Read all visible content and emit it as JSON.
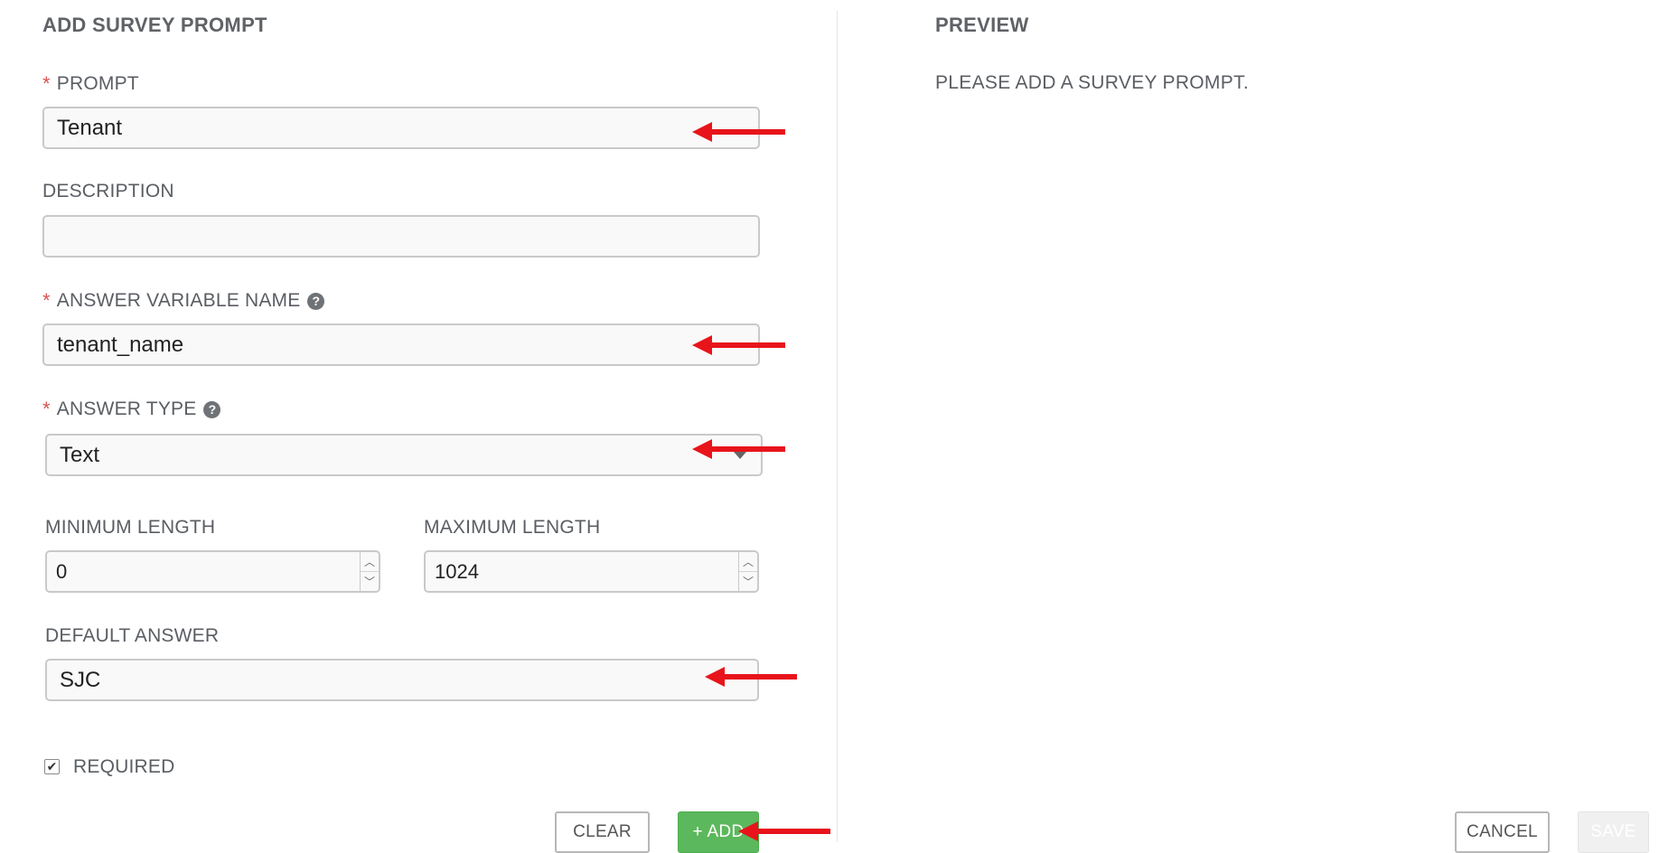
{
  "left_panel": {
    "title": "ADD SURVEY PROMPT",
    "prompt": {
      "label": "PROMPT",
      "required_mark": "*",
      "value": "Tenant"
    },
    "description": {
      "label": "DESCRIPTION",
      "value": ""
    },
    "answer_variable_name": {
      "label": "ANSWER VARIABLE NAME",
      "required_mark": "*",
      "help_icon": "question-circle-icon",
      "value": "tenant_name"
    },
    "answer_type": {
      "label": "ANSWER TYPE",
      "required_mark": "*",
      "help_icon": "question-circle-icon",
      "selected": "Text"
    },
    "minimum_length": {
      "label": "MINIMUM LENGTH",
      "value": "0"
    },
    "maximum_length": {
      "label": "MAXIMUM LENGTH",
      "value": "1024"
    },
    "default_answer": {
      "label": "DEFAULT ANSWER",
      "value": "SJC"
    },
    "required": {
      "label": "REQUIRED",
      "checked": true
    },
    "buttons": {
      "clear": "CLEAR",
      "add": "+ ADD"
    }
  },
  "right_panel": {
    "title": "PREVIEW",
    "message": "PLEASE ADD A SURVEY PROMPT.",
    "buttons": {
      "cancel": "CANCEL",
      "save": "SAVE"
    }
  },
  "colors": {
    "required_star": "#d9534f",
    "add_button": "#5cb85c",
    "annotation_arrow": "#e8141b"
  }
}
